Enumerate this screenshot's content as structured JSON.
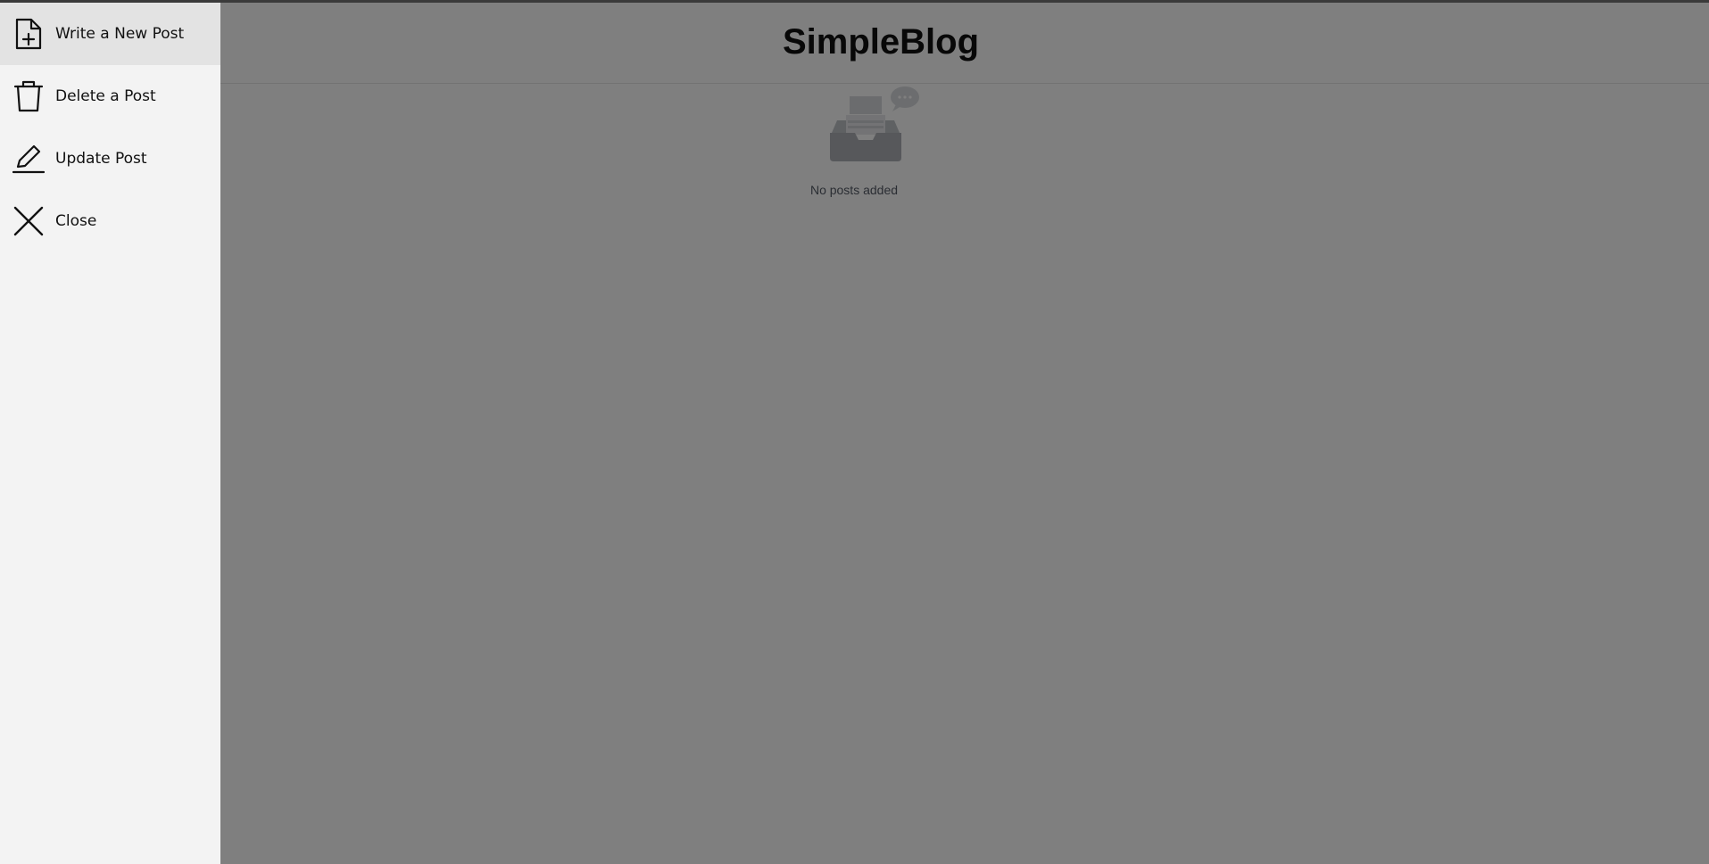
{
  "app": {
    "title": "SimpleBlog"
  },
  "empty_state": {
    "message": "No posts added",
    "icon": "empty-inbox-icon"
  },
  "drawer": {
    "items": [
      {
        "label": "Write a New Post",
        "icon": "file-add-icon",
        "active": true
      },
      {
        "label": "Delete a Post",
        "icon": "trash-icon",
        "active": false
      },
      {
        "label": "Update Post",
        "icon": "pencil-icon",
        "active": false
      },
      {
        "label": "Close",
        "icon": "close-icon",
        "active": false
      }
    ]
  },
  "colors": {
    "overlay": "rgba(0,0,0,0.5)",
    "drawer_background": "#f3f3f3",
    "drawer_active": "#e3e3e3"
  }
}
